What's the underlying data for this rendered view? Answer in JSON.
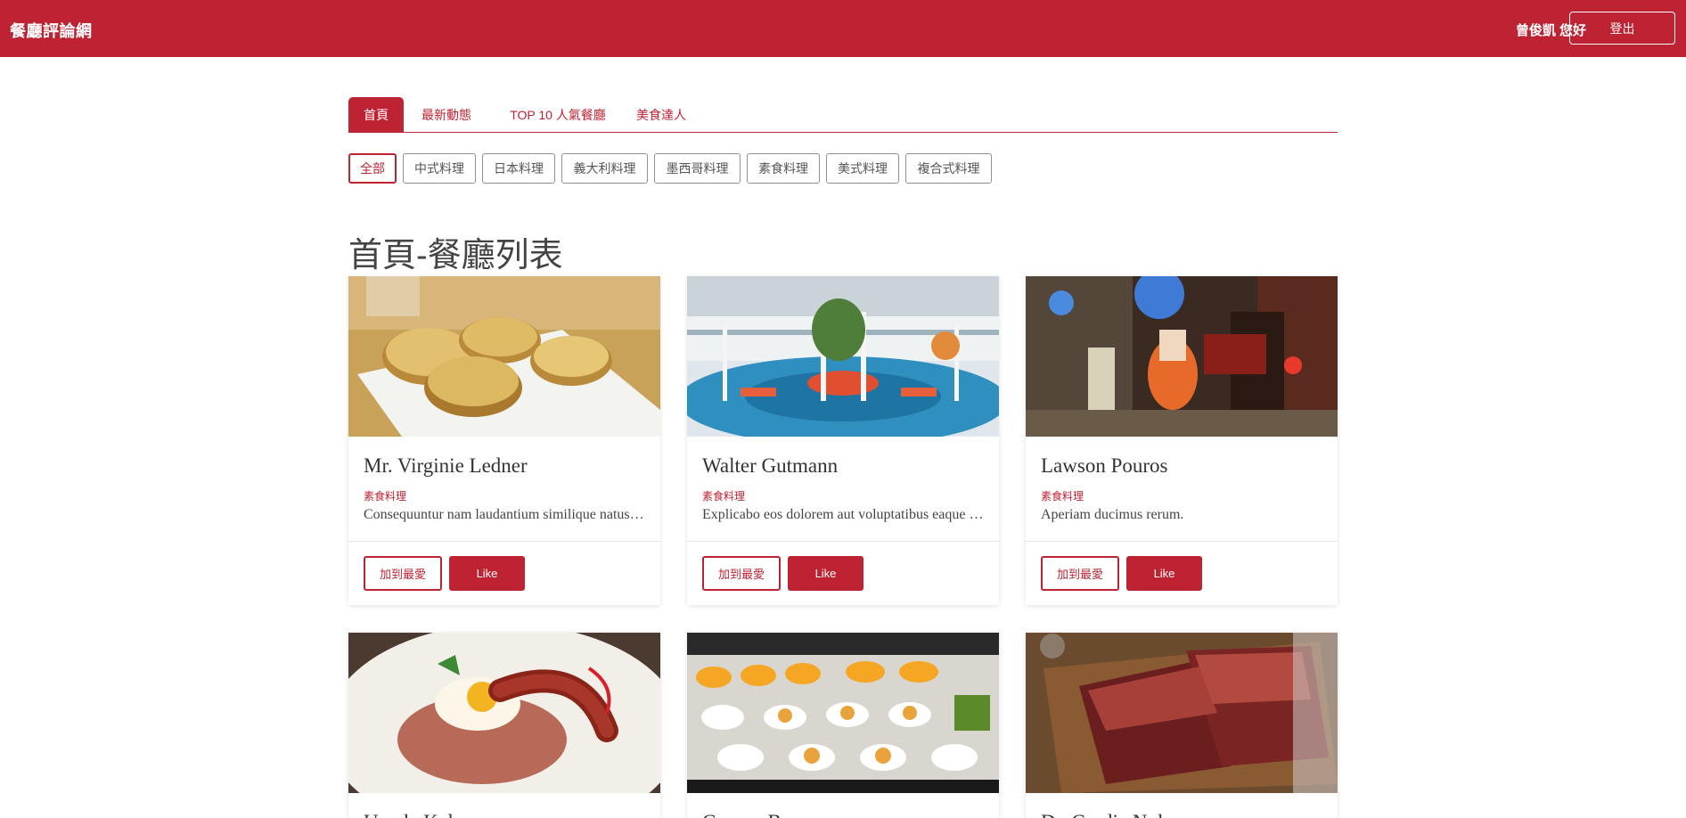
{
  "navbar": {
    "brand": "餐廳評論網",
    "greeting": "曾俊凱 您好",
    "logout_label": "登出"
  },
  "tabs": [
    {
      "label": "首頁",
      "active": true
    },
    {
      "label": "最新動態",
      "active": false
    },
    {
      "label": "TOP 10 人氣餐廳",
      "active": false
    },
    {
      "label": "美食達人",
      "active": false
    }
  ],
  "filters": [
    {
      "label": "全部",
      "active": true
    },
    {
      "label": "中式料理",
      "active": false
    },
    {
      "label": "日本料理",
      "active": false
    },
    {
      "label": "義大利料理",
      "active": false
    },
    {
      "label": "墨西哥料理",
      "active": false
    },
    {
      "label": "素食料理",
      "active": false
    },
    {
      "label": "美式料理",
      "active": false
    },
    {
      "label": "複合式料理",
      "active": false
    }
  ],
  "page_title": "首頁-餐廳列表",
  "cards": [
    {
      "name": "Mr. Virginie Ledner",
      "category": "素食料理",
      "description": "Consequuntur nam laudantium similique natus voluptatem.",
      "fav_label": "加到最愛",
      "like_label": "Like",
      "image": "potato-cakes-photo"
    },
    {
      "name": "Walter Gutmann",
      "category": "素食料理",
      "description": "Explicabo eos dolorem aut voluptatibus eaque quia.",
      "fav_label": "加到最愛",
      "like_label": "Like",
      "image": "blue-lounge-photo"
    },
    {
      "name": "Lawson Pouros",
      "category": "素食料理",
      "description": "Aperiam ducimus rerum.",
      "fav_label": "加到最愛",
      "like_label": "Like",
      "image": "night-street-photo"
    },
    {
      "name": "Ursula Kub",
      "category": "",
      "description": "",
      "fav_label": "",
      "like_label": "",
      "image": "fried-rice-egg-photo"
    },
    {
      "name": "Conner Bu",
      "category": "",
      "description": "",
      "fav_label": "",
      "like_label": "",
      "image": "buffet-plates-photo"
    },
    {
      "name": "Dr. Cordie Nol",
      "category": "",
      "description": "",
      "fav_label": "",
      "like_label": "",
      "image": "grilled-steak-photo"
    }
  ],
  "colors": {
    "brand": "#bd2333",
    "text": "#333333",
    "border": "#8f8f8f"
  }
}
